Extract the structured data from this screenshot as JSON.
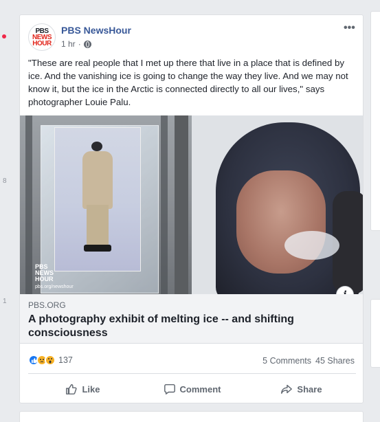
{
  "left_rail": {
    "numbers": [
      "8",
      "1"
    ]
  },
  "post": {
    "page_name": "PBS NewsHour",
    "avatar_text": [
      "PBS",
      "NEWS",
      "HOUR"
    ],
    "time": "1 hr",
    "caption": "\"These are real people that I met up there that live in a place that is defined by ice. And the vanishing ice is going to change the way they live. And we may not know it, but the ice in the Arctic is connected directly to all our lives,\" says photographer Louie Palu.",
    "image_logo": [
      "PBS",
      "NEWS",
      "HOUR"
    ],
    "image_url": "pbs.org/newshour",
    "info_icon": "i",
    "link": {
      "domain": "PBS.ORG",
      "title": "A photography exhibit of melting ice -- and shifting consciousness"
    },
    "reactions": {
      "icons": [
        "like-icon",
        "sad-icon",
        "wow-icon"
      ],
      "count": "137"
    },
    "comments": "5 Comments",
    "shares": "45 Shares",
    "actions": {
      "like": "Like",
      "comment": "Comment",
      "share": "Share"
    }
  },
  "colors": {
    "page_background": "#e9ebee",
    "page_name": "#385898",
    "like_blue": "#1877f2",
    "pbs_red": "#e1251b"
  }
}
